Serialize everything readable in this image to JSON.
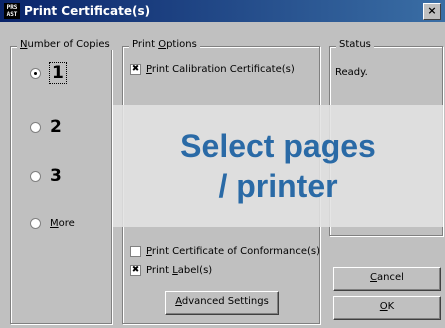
{
  "window": {
    "title": "Print Certificate(s)",
    "icon": "printer-app-icon",
    "icon_text_line1": "PRS",
    "icon_text_line2": "AST",
    "close_glyph": "×"
  },
  "copies": {
    "legend_prefix": "",
    "legend_accel": "N",
    "legend_rest": "umber of Copies",
    "options": [
      {
        "label": "1",
        "selected": true
      },
      {
        "label": "2",
        "selected": false
      },
      {
        "label": "3",
        "selected": false
      },
      {
        "label_accel": "M",
        "label_rest": "ore",
        "selected": false
      }
    ]
  },
  "print_options": {
    "legend_prefix": "Print ",
    "legend_accel": "O",
    "legend_rest": "ptions",
    "calibration": {
      "accel": "P",
      "rest": "rint Calibration Certificate(s)",
      "checked": true
    },
    "conformance": {
      "accel": "P",
      "rest": "rint Certificate of Conformance(s)",
      "checked": false
    },
    "label": {
      "prefix": "Print ",
      "accel": "L",
      "rest": "abel(s)",
      "checked": true
    },
    "advanced_button": {
      "accel": "A",
      "rest": "dvanced Settings"
    }
  },
  "status": {
    "legend": "Status",
    "text": "Ready."
  },
  "buttons": {
    "cancel": {
      "accel": "C",
      "rest": "ancel"
    },
    "ok": {
      "accel": "O",
      "rest": "K"
    }
  },
  "overlay": {
    "line1": "Select pages",
    "line2": "/ printer",
    "color": "#2a6aa6"
  },
  "check_glyph": "✖"
}
